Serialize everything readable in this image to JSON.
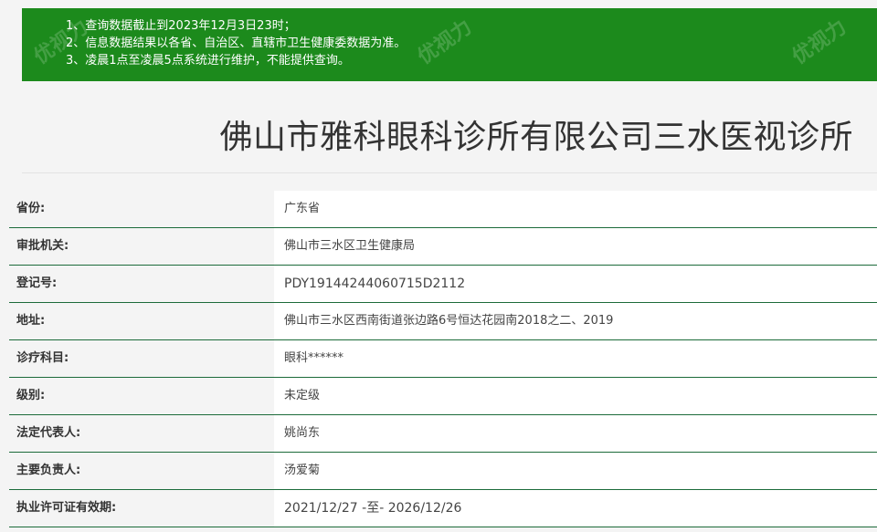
{
  "notice": {
    "lines": [
      "1、查询数据截止到2023年12月3日23时；",
      "2、信息数据结果以各省、自治区、直辖市卫生健康委数据为准。",
      "3、凌晨1点至凌晨5点系统进行维护，不能提供查询。"
    ]
  },
  "title": "佛山市雅科眼科诊所有限公司三水医视诊所",
  "rows": [
    {
      "label": "省份:",
      "value": "广东省"
    },
    {
      "label": "审批机关:",
      "value": "佛山市三水区卫生健康局"
    },
    {
      "label": "登记号:",
      "value": "PDY19144244060715D2112"
    },
    {
      "label": "地址:",
      "value": "佛山市三水区西南街道张边路6号恒达花园南2018之二、2019"
    },
    {
      "label": "诊疗科目:",
      "value": "眼科******"
    },
    {
      "label": "级别:",
      "value": "未定级"
    },
    {
      "label": "法定代表人:",
      "value": "姚尚东"
    },
    {
      "label": "主要负责人:",
      "value": "汤爱菊"
    },
    {
      "label": "执业许可证有效期:",
      "value": "2021/12/27 -至- 2026/12/26"
    }
  ],
  "watermark": "优视力"
}
